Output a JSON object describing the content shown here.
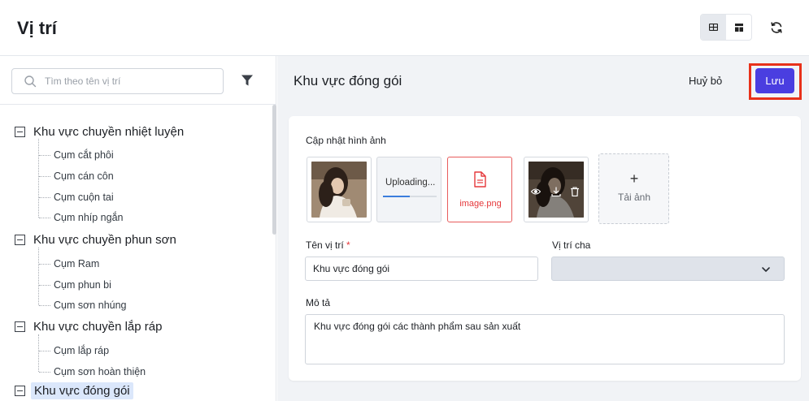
{
  "header": {
    "title": "Vị trí"
  },
  "search": {
    "placeholder": "Tìm theo tên vị trí"
  },
  "tree": {
    "groups": [
      {
        "label": "Khu vực chuyền nhiệt luyện",
        "children": [
          "Cụm cắt phôi",
          "Cụm cán côn",
          "Cụm cuộn tai",
          "Cụm nhíp ngắn"
        ]
      },
      {
        "label": "Khu vực chuyền phun sơn",
        "children": [
          "Cụm Ram",
          "Cụm phun bi",
          "Cụm sơn nhúng"
        ]
      },
      {
        "label": "Khu vực chuyền lắp ráp",
        "children": [
          "Cụm lắp ráp",
          "Cụm sơn hoàn thiện"
        ]
      },
      {
        "label": "Khu vực đóng gói",
        "children": []
      }
    ],
    "selected": "Khu vực đóng gói"
  },
  "detail": {
    "title": "Khu vực đóng gói",
    "cancel_label": "Huỷ bỏ",
    "save_label": "Lưu",
    "images_label": "Cập nhật hình ảnh",
    "uploading_text": "Uploading...",
    "upload_progress": 0.5,
    "error_file_name": "image.png",
    "add_image_label": "Tải ảnh",
    "add_icon": "+",
    "name_label": "Tên vị trí",
    "required_mark": "*",
    "name_value": "Khu vực đóng gói",
    "parent_label": "Vị trí cha",
    "parent_value": "",
    "description_label": "Mô tả",
    "description_value": "Khu vực đóng gói các thành phẩm sau sản xuất"
  },
  "colors": {
    "primary": "#4a3ee0",
    "highlight_box": "#e8311a",
    "error": "#e5383b",
    "selected_bg": "#dbe7fb"
  },
  "icons": [
    "table-view-icon",
    "card-view-icon",
    "refresh-icon",
    "search-icon",
    "filter-icon",
    "file-icon",
    "eye-icon",
    "download-icon",
    "trash-icon",
    "chevron-down-icon"
  ]
}
